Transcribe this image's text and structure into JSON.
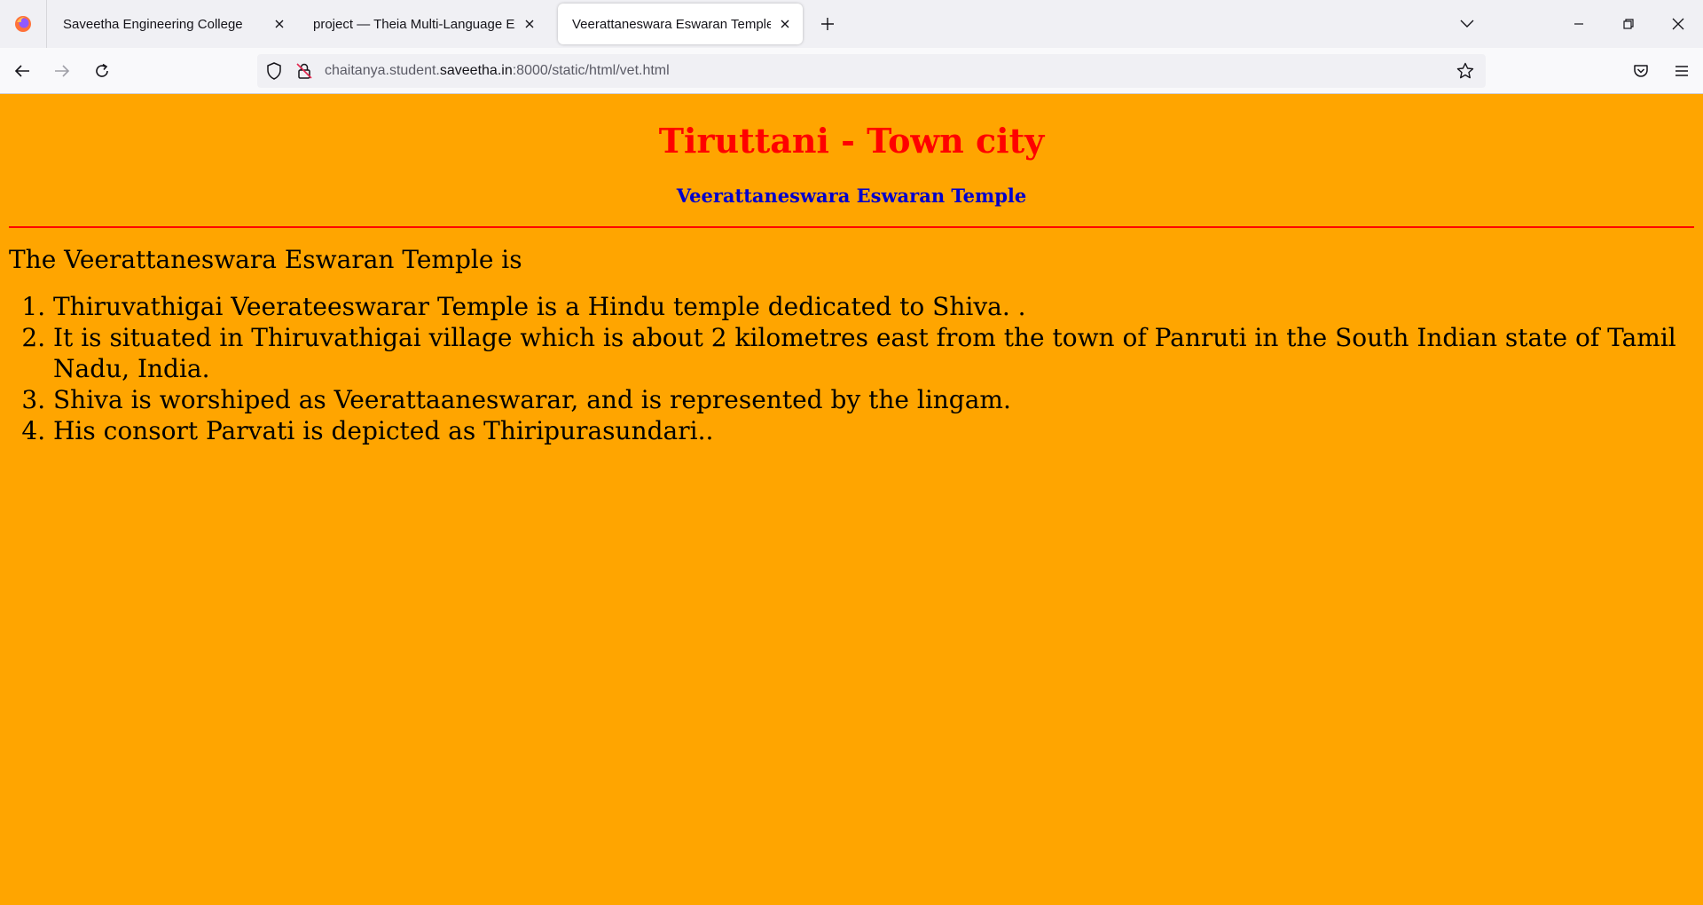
{
  "browser": {
    "tabs": [
      {
        "title": "Saveetha Engineering College"
      },
      {
        "title": "project — Theia Multi-Language Ex"
      },
      {
        "title": "Veerattaneswara Eswaran Temple",
        "active": true
      }
    ],
    "url": {
      "prefix": "chaitanya.student.",
      "domain": "saveetha.in",
      "suffix": ":8000/static/html/vet.html"
    },
    "icons": {
      "logo": "firefox-icon",
      "back": "back-arrow-icon",
      "forward": "forward-arrow-icon",
      "reload": "reload-icon",
      "shield": "shield-icon",
      "insecure": "insecure-lock-icon",
      "bookmark": "star-icon",
      "pocket": "pocket-icon",
      "menu": "hamburger-menu-icon"
    }
  },
  "page": {
    "title": "Tiruttani - Town city",
    "subtitle": "Veerattaneswara Eswaran Temple",
    "intro": "The Veerattaneswara Eswaran Temple is",
    "items": [
      "Thiruvathigai Veerateeswarar Temple is a Hindu temple dedicated to Shiva. .",
      "It is situated in Thiruvathigai village which is about 2 kilometres east from the town of Panruti in the South Indian state of Tamil Nadu, India.",
      "Shiva is worshiped as Veerattaaneswarar, and is represented by the lingam.",
      "His consort Parvati is depicted as Thiripurasundari.."
    ],
    "colors": {
      "background": "#ffa500",
      "title": "#ff0000",
      "subtitle": "#0000cd",
      "rule": "#ff0000"
    }
  }
}
